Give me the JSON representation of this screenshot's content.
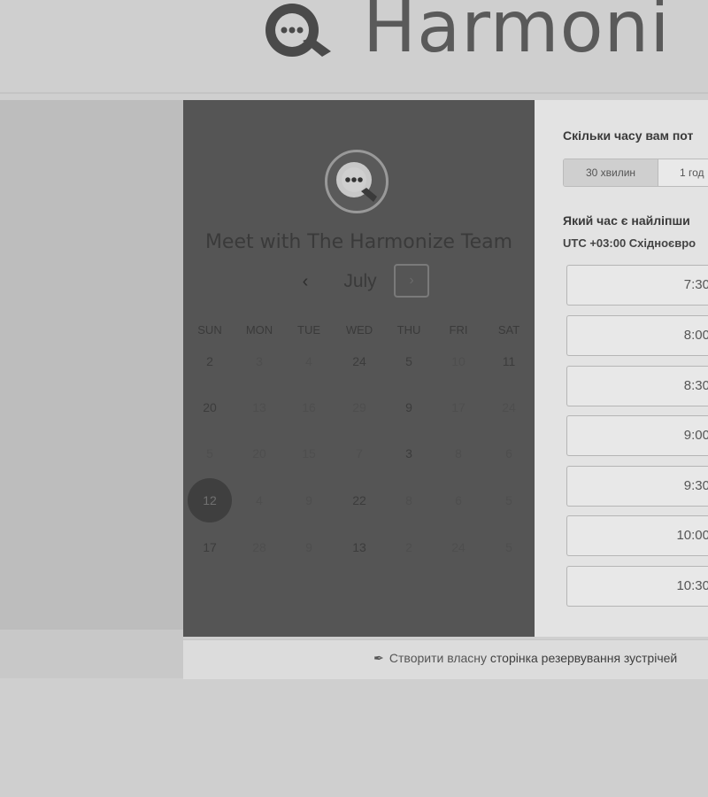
{
  "brand": {
    "name": "Harmoni"
  },
  "calendar": {
    "title": "Meet with The Harmonize Team",
    "month": "July",
    "prev_symbol": "‹",
    "next_symbol": "›",
    "weekdays": [
      "SUN",
      "MON",
      "TUE",
      "WED",
      "THU",
      "FRI",
      "SAT"
    ],
    "days": [
      {
        "label": "2",
        "faint": false
      },
      {
        "label": "3",
        "faint": true
      },
      {
        "label": "4",
        "faint": true
      },
      {
        "label": "24",
        "faint": false
      },
      {
        "label": "5",
        "faint": false
      },
      {
        "label": "10",
        "faint": true
      },
      {
        "label": "11",
        "faint": false
      },
      {
        "label": "20",
        "faint": false
      },
      {
        "label": "13",
        "faint": true
      },
      {
        "label": "16",
        "faint": true
      },
      {
        "label": "29",
        "faint": true
      },
      {
        "label": "9",
        "faint": false
      },
      {
        "label": "17",
        "faint": true
      },
      {
        "label": "24",
        "faint": true
      },
      {
        "label": "5",
        "faint": true
      },
      {
        "label": "20",
        "faint": true
      },
      {
        "label": "15",
        "faint": true
      },
      {
        "label": "7",
        "faint": true
      },
      {
        "label": "3",
        "faint": false
      },
      {
        "label": "8",
        "faint": true
      },
      {
        "label": "6",
        "faint": true
      },
      {
        "label": "12",
        "faint": false,
        "selected": true
      },
      {
        "label": "4",
        "faint": true
      },
      {
        "label": "9",
        "faint": true
      },
      {
        "label": "22",
        "faint": false
      },
      {
        "label": "8",
        "faint": true
      },
      {
        "label": "6",
        "faint": true
      },
      {
        "label": "5",
        "faint": true
      },
      {
        "label": "17",
        "faint": false
      },
      {
        "label": "28",
        "faint": true
      },
      {
        "label": "9",
        "faint": true
      },
      {
        "label": "13",
        "faint": false
      },
      {
        "label": "2",
        "faint": true
      },
      {
        "label": "24",
        "faint": true
      },
      {
        "label": "5",
        "faint": true
      }
    ]
  },
  "booking": {
    "duration_question": "Скільки часу вам пот",
    "durations": [
      "30 хвилин",
      "1 год"
    ],
    "time_question": "Який час є найліпши",
    "timezone": "UTC +03:00 Східноєвро",
    "slots": [
      "7:30",
      "8:00",
      "8:30",
      "9:00",
      "9:30",
      "10:00",
      "10:30"
    ]
  },
  "footer": {
    "link_prefix": "Створити власну ",
    "link_strong": "сторінка резервування зустрічей"
  },
  "colors": {
    "panel": "#555555",
    "background": "#cfcfcf"
  }
}
